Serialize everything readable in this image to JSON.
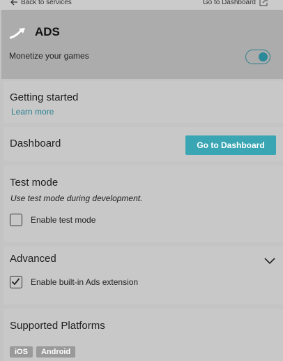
{
  "topbar": {
    "back_label": "Back to services",
    "dashboard_label": "Go to Dashboard"
  },
  "header": {
    "title": "ADS",
    "monetize_label": "Monetize your games",
    "monetize_enabled": true,
    "accent_color": "#2b8a9a"
  },
  "getting_started": {
    "title": "Getting started",
    "learn_more": "Learn more"
  },
  "dashboard": {
    "title": "Dashboard",
    "button_label": "Go to Dashboard"
  },
  "test_mode": {
    "title": "Test mode",
    "subtitle": "Use test mode during development.",
    "checkbox_label": "Enable test mode",
    "checked": false
  },
  "advanced": {
    "title": "Advanced",
    "checkbox_label": "Enable built-in Ads extension",
    "checked": true
  },
  "platforms": {
    "title": "Supported Platforms",
    "tags": [
      "iOS",
      "Android"
    ]
  }
}
